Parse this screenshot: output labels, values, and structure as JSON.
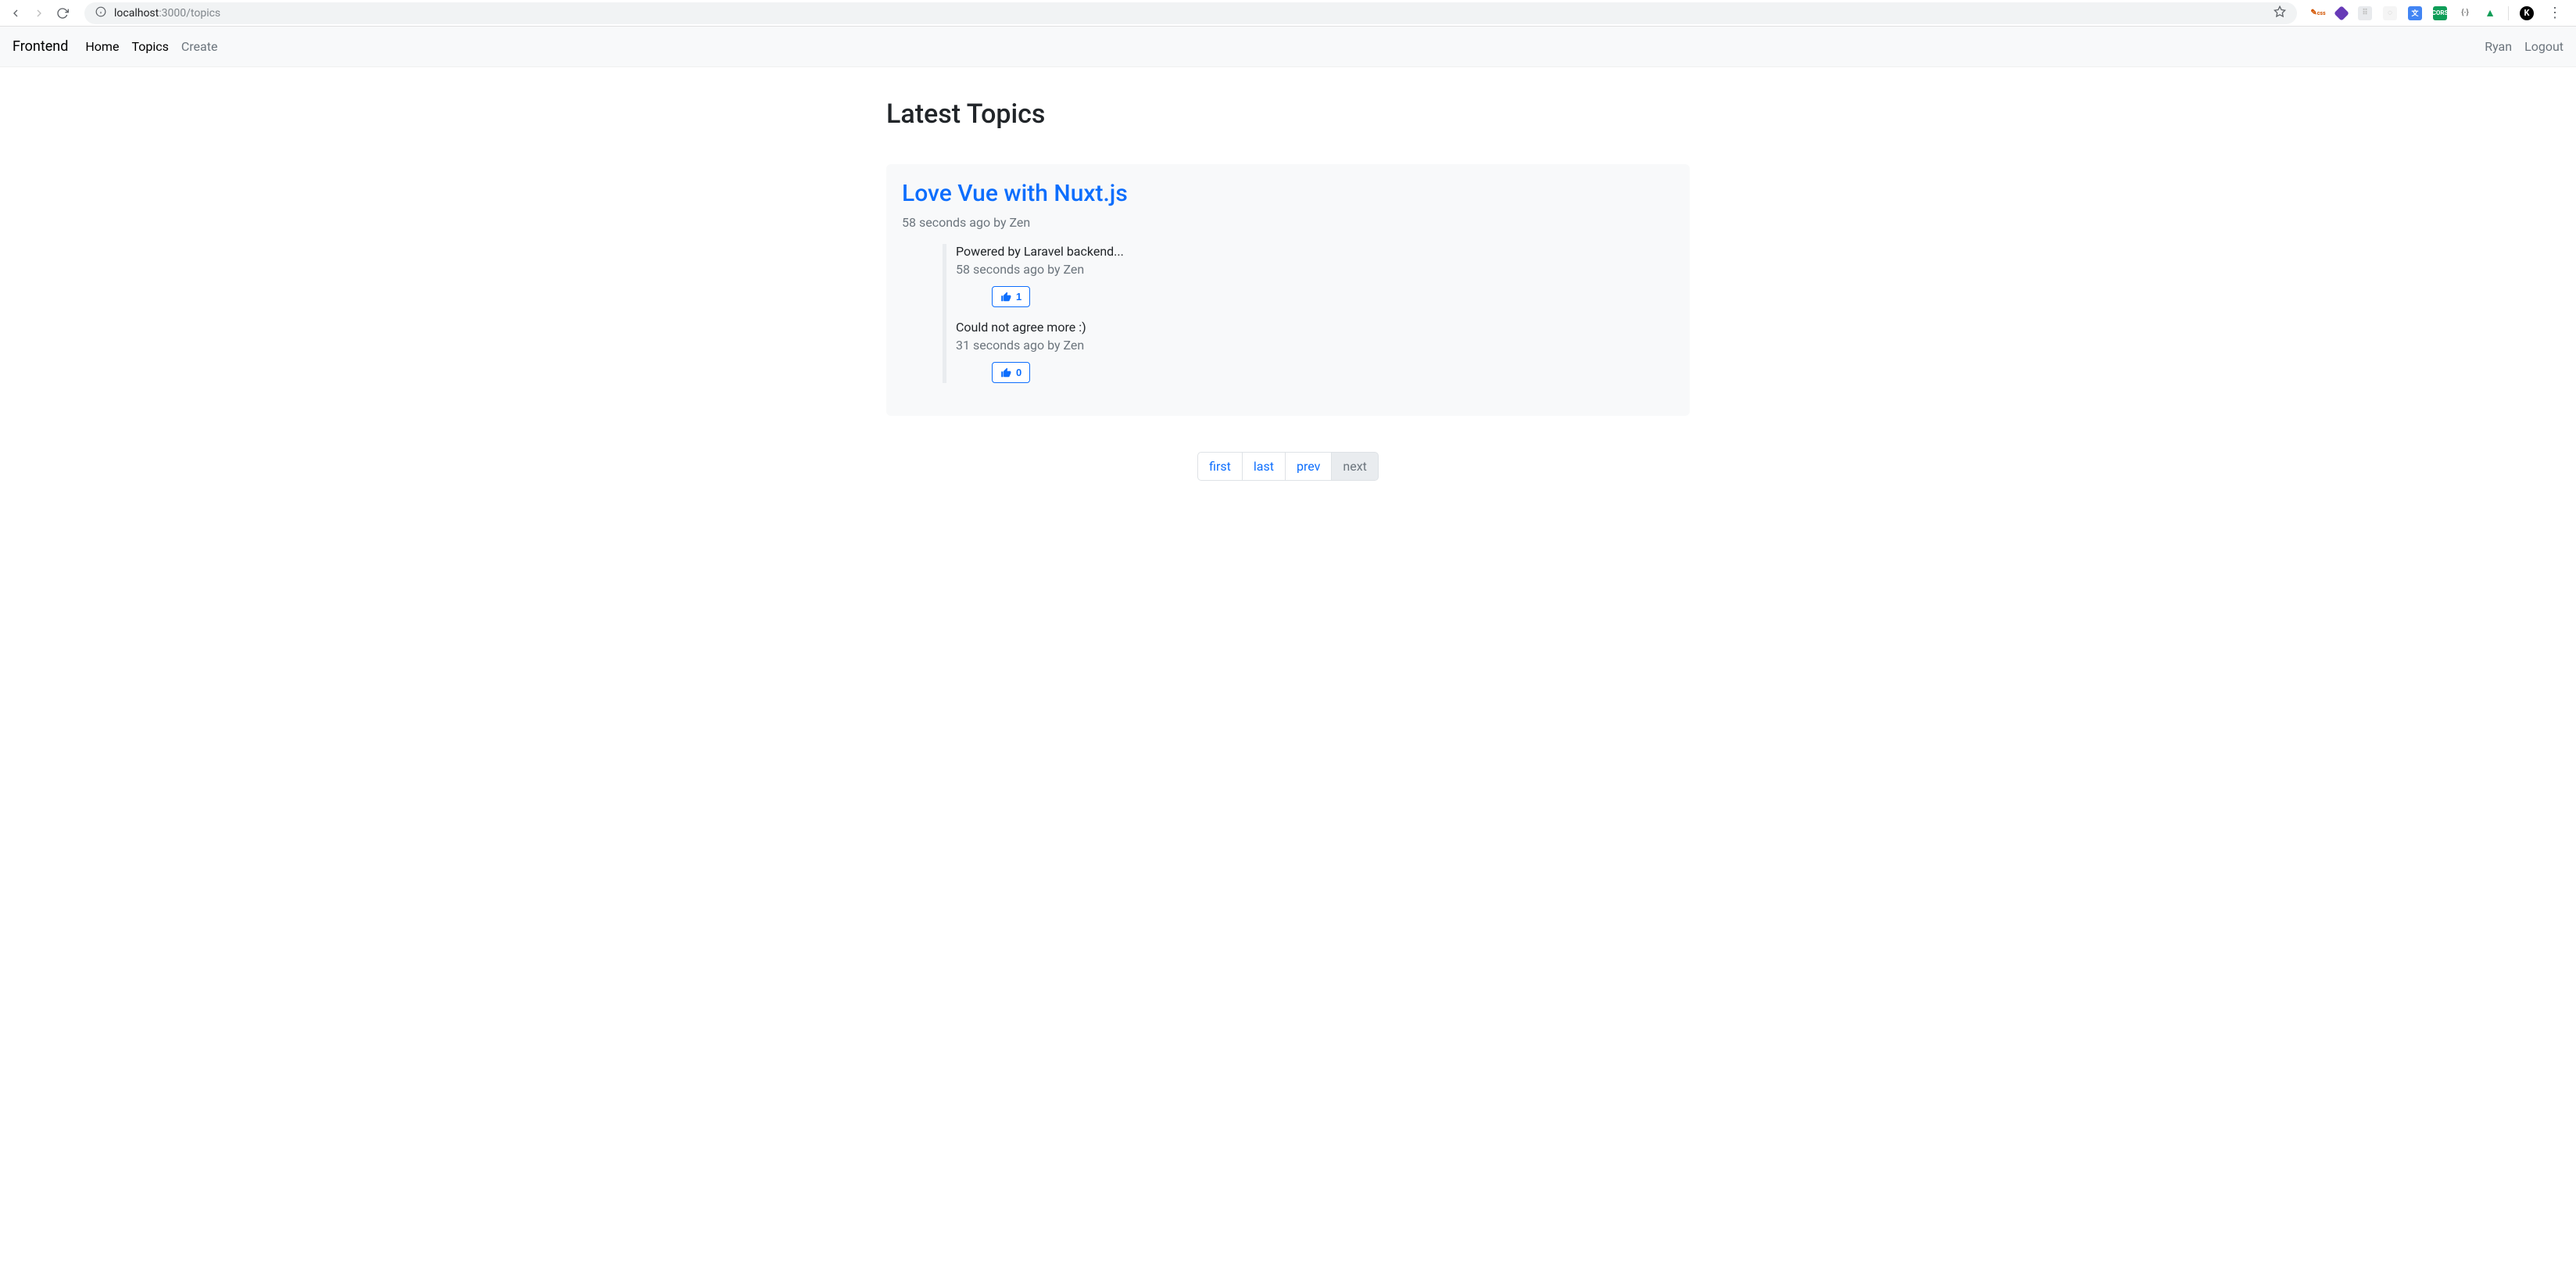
{
  "browser": {
    "url_faded": "localhost",
    "url_port": ":3000",
    "url_path": "/topics"
  },
  "nav": {
    "brand": "Frontend",
    "home": "Home",
    "topics": "Topics",
    "create": "Create",
    "user": "Ryan",
    "logout": "Logout"
  },
  "page": {
    "title": "Latest Topics"
  },
  "topic": {
    "title": "Love Vue with Nuxt.js",
    "meta": "58 seconds ago by Zen",
    "posts": [
      {
        "body": "Powered by Laravel backend...",
        "meta": "58 seconds ago by Zen",
        "likes": "1"
      },
      {
        "body": "Could not agree more :)",
        "meta": "31 seconds ago by Zen",
        "likes": "0"
      }
    ]
  },
  "pagination": {
    "first": "first",
    "last": "last",
    "prev": "prev",
    "next": "next"
  }
}
